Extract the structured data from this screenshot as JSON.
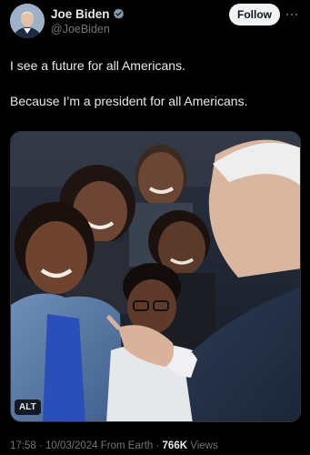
{
  "author": {
    "display_name": "Joe Biden",
    "handle": "@JoeBiden",
    "verified": true
  },
  "follow_label": "Follow",
  "tweet": {
    "paragraphs": [
      "I see a future for all Americans.",
      "Because I’m a president for all Americans."
    ]
  },
  "media": {
    "alt_badge": "ALT"
  },
  "meta": {
    "time": "17:58",
    "separator_1": " · ",
    "date": "10/03/2024",
    "source": " From Earth",
    "separator_2": " · ",
    "views_count": "766K",
    "views_label": " Views"
  },
  "colors": {
    "background": "#000000",
    "text_primary": "#e7e9ea",
    "text_secondary": "#71767b",
    "verified_badge": "#829aab",
    "follow_button_bg": "#eff3f4"
  }
}
